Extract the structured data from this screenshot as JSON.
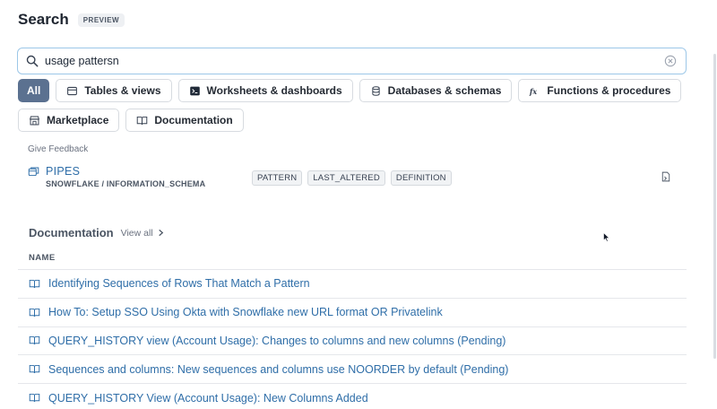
{
  "header": {
    "title": "Search",
    "badge": "PREVIEW"
  },
  "search": {
    "value": "usage pattersn",
    "placeholder": "Search"
  },
  "filters": [
    {
      "label": "All",
      "icon": "none",
      "active": true
    },
    {
      "label": "Tables & views",
      "icon": "table-icon",
      "active": false
    },
    {
      "label": "Worksheets & dashboards",
      "icon": "terminal-icon",
      "active": false
    },
    {
      "label": "Databases & schemas",
      "icon": "database-icon",
      "active": false
    },
    {
      "label": "Functions & procedures",
      "icon": "function-icon",
      "active": false
    },
    {
      "label": "Marketplace",
      "icon": "store-icon",
      "active": false
    },
    {
      "label": "Documentation",
      "icon": "book-icon",
      "active": false
    }
  ],
  "feedback": "Give Feedback",
  "result": {
    "name": "PIPES",
    "path": "SNOWFLAKE / INFORMATION_SCHEMA",
    "tags": [
      "PATTERN",
      "LAST_ALTERED",
      "DEFINITION"
    ],
    "icon": "view-icon"
  },
  "documentation": {
    "title": "Documentation",
    "view_all": "View all",
    "column_header": "NAME",
    "items": [
      "Identifying Sequences of Rows That Match a Pattern",
      "How To: Setup SSO Using Okta with Snowflake new URL format OR Privatelink",
      "QUERY_HISTORY view (Account Usage): Changes to columns and new columns (Pending)",
      "Sequences and columns: New sequences and columns use NOORDER by default (Pending)",
      "QUERY_HISTORY View (Account Usage): New Columns Added"
    ]
  },
  "colors": {
    "link": "#2f6ea8",
    "active_chip": "#5b7190",
    "search_border": "#9cc7e8"
  }
}
